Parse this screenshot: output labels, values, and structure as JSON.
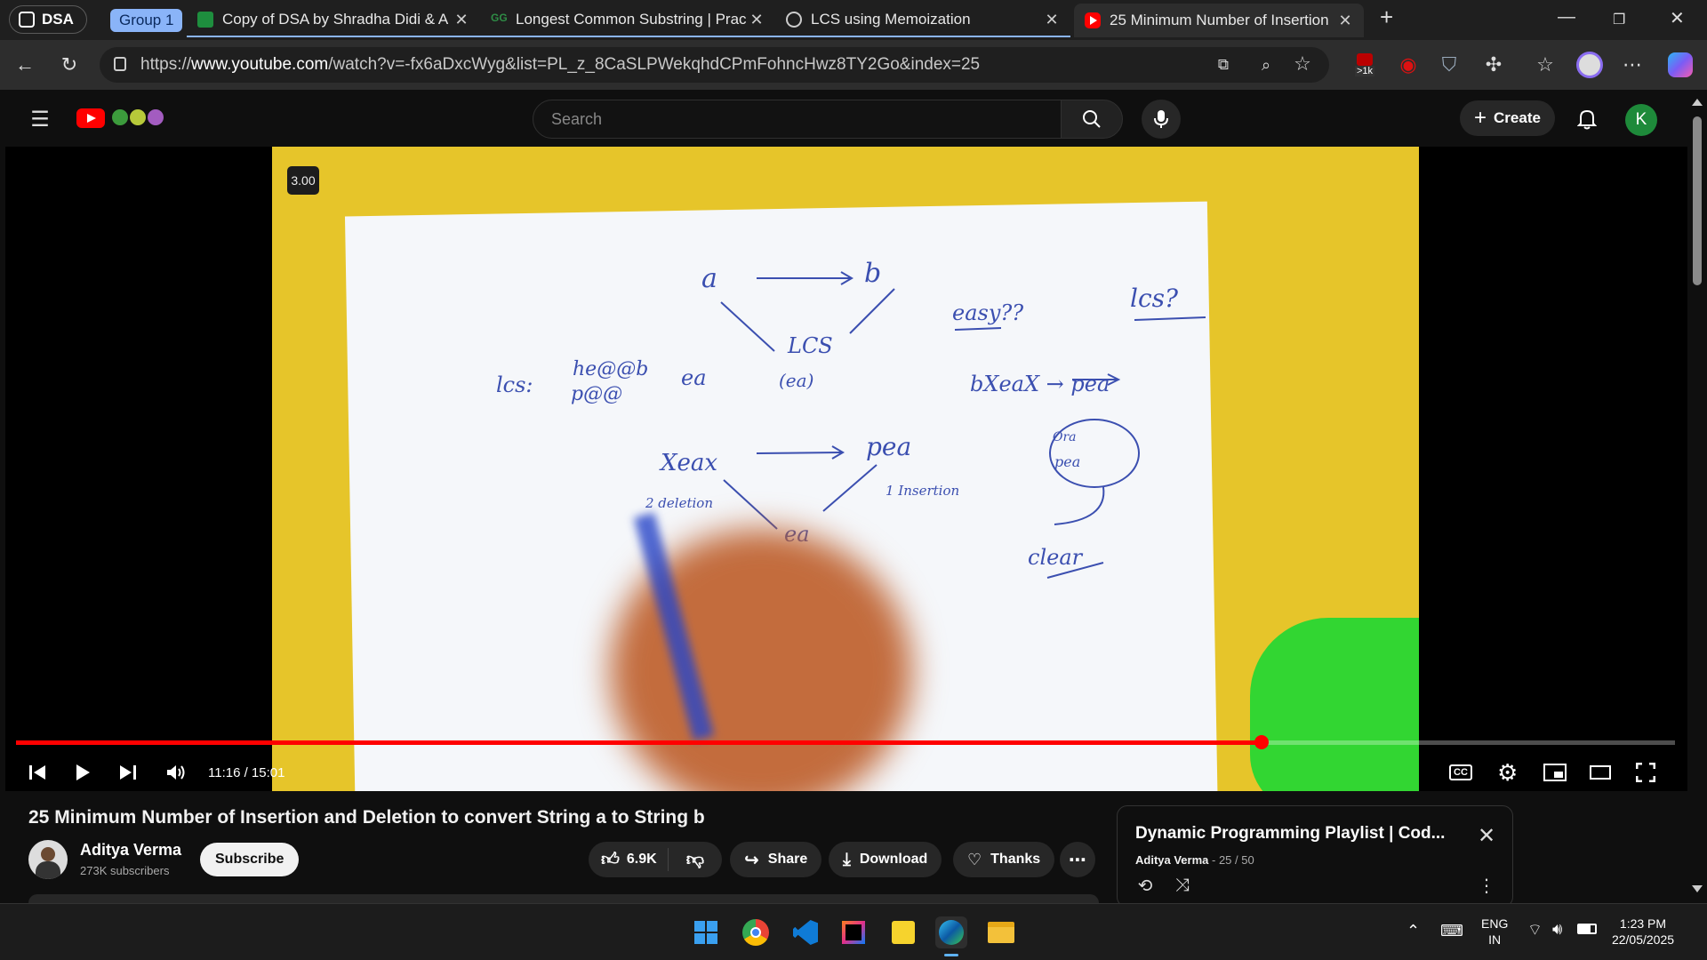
{
  "browser": {
    "workspace_label": "DSA",
    "group_label": "Group 1",
    "tabs": [
      {
        "title": "Copy of DSA by Shradha Didi & A",
        "icon": "sheets-icon",
        "color": "#1e8e3e"
      },
      {
        "title": "Longest Common Substring | Prac",
        "icon": "gfg-icon",
        "color": "#2f8d46"
      },
      {
        "title": "LCS using Memoization",
        "icon": "chatgpt-icon",
        "color": "#ffffff"
      },
      {
        "title": "25 Minimum Number of Insertion",
        "icon": "youtube-icon",
        "color": "#ff0000"
      }
    ],
    "url_prefix": "https://",
    "url_domain": "www.youtube.com",
    "url_path": "/watch?v=-fx6aDxcWyg&list=PL_z_8CaSLPWekqhdCPmFohncHwz8TY2Go&index=25",
    "extension_badge": ">1k"
  },
  "youtube": {
    "search_placeholder": "Search",
    "create_label": "Create",
    "avatar_letter": "K",
    "player": {
      "speed_badge": "3.00",
      "time": "11:16 / 15:01",
      "progress": 0.751,
      "whiteboard": {
        "a": "a",
        "b": "b",
        "lcs_center": "LCS",
        "lcs_sub": "(ea)",
        "lcs_left": "lcs:",
        "w1": "he@@b",
        "w2": "p@@",
        "w_ea": "ea",
        "easy": "easy??",
        "lcs_q": "lcs?",
        "heap_to_pea": "bXeaX → pea",
        "heap": "Xeax",
        "pea": "pea",
        "ea": "ea",
        "two_del": "2 deletion",
        "one_ins": "1 Insertion",
        "circle1": "Ora",
        "circle2": "pea",
        "clear": "clear"
      }
    },
    "video_title": "25 Minimum Number of Insertion and Deletion to convert String a to String b",
    "channel": {
      "name": "Aditya Verma",
      "subscribers": "273K subscribers",
      "subscribe_label": "Subscribe"
    },
    "actions": {
      "likes": "6.9K",
      "share": "Share",
      "download": "Download",
      "thanks": "Thanks"
    },
    "playlist": {
      "title": "Dynamic Programming Playlist | Cod...",
      "author": "Aditya Verma",
      "position": "- 25 / 50"
    }
  },
  "taskbar": {
    "lang": "ENG",
    "region": "IN",
    "time": "1:23 PM",
    "date": "22/05/2025"
  }
}
